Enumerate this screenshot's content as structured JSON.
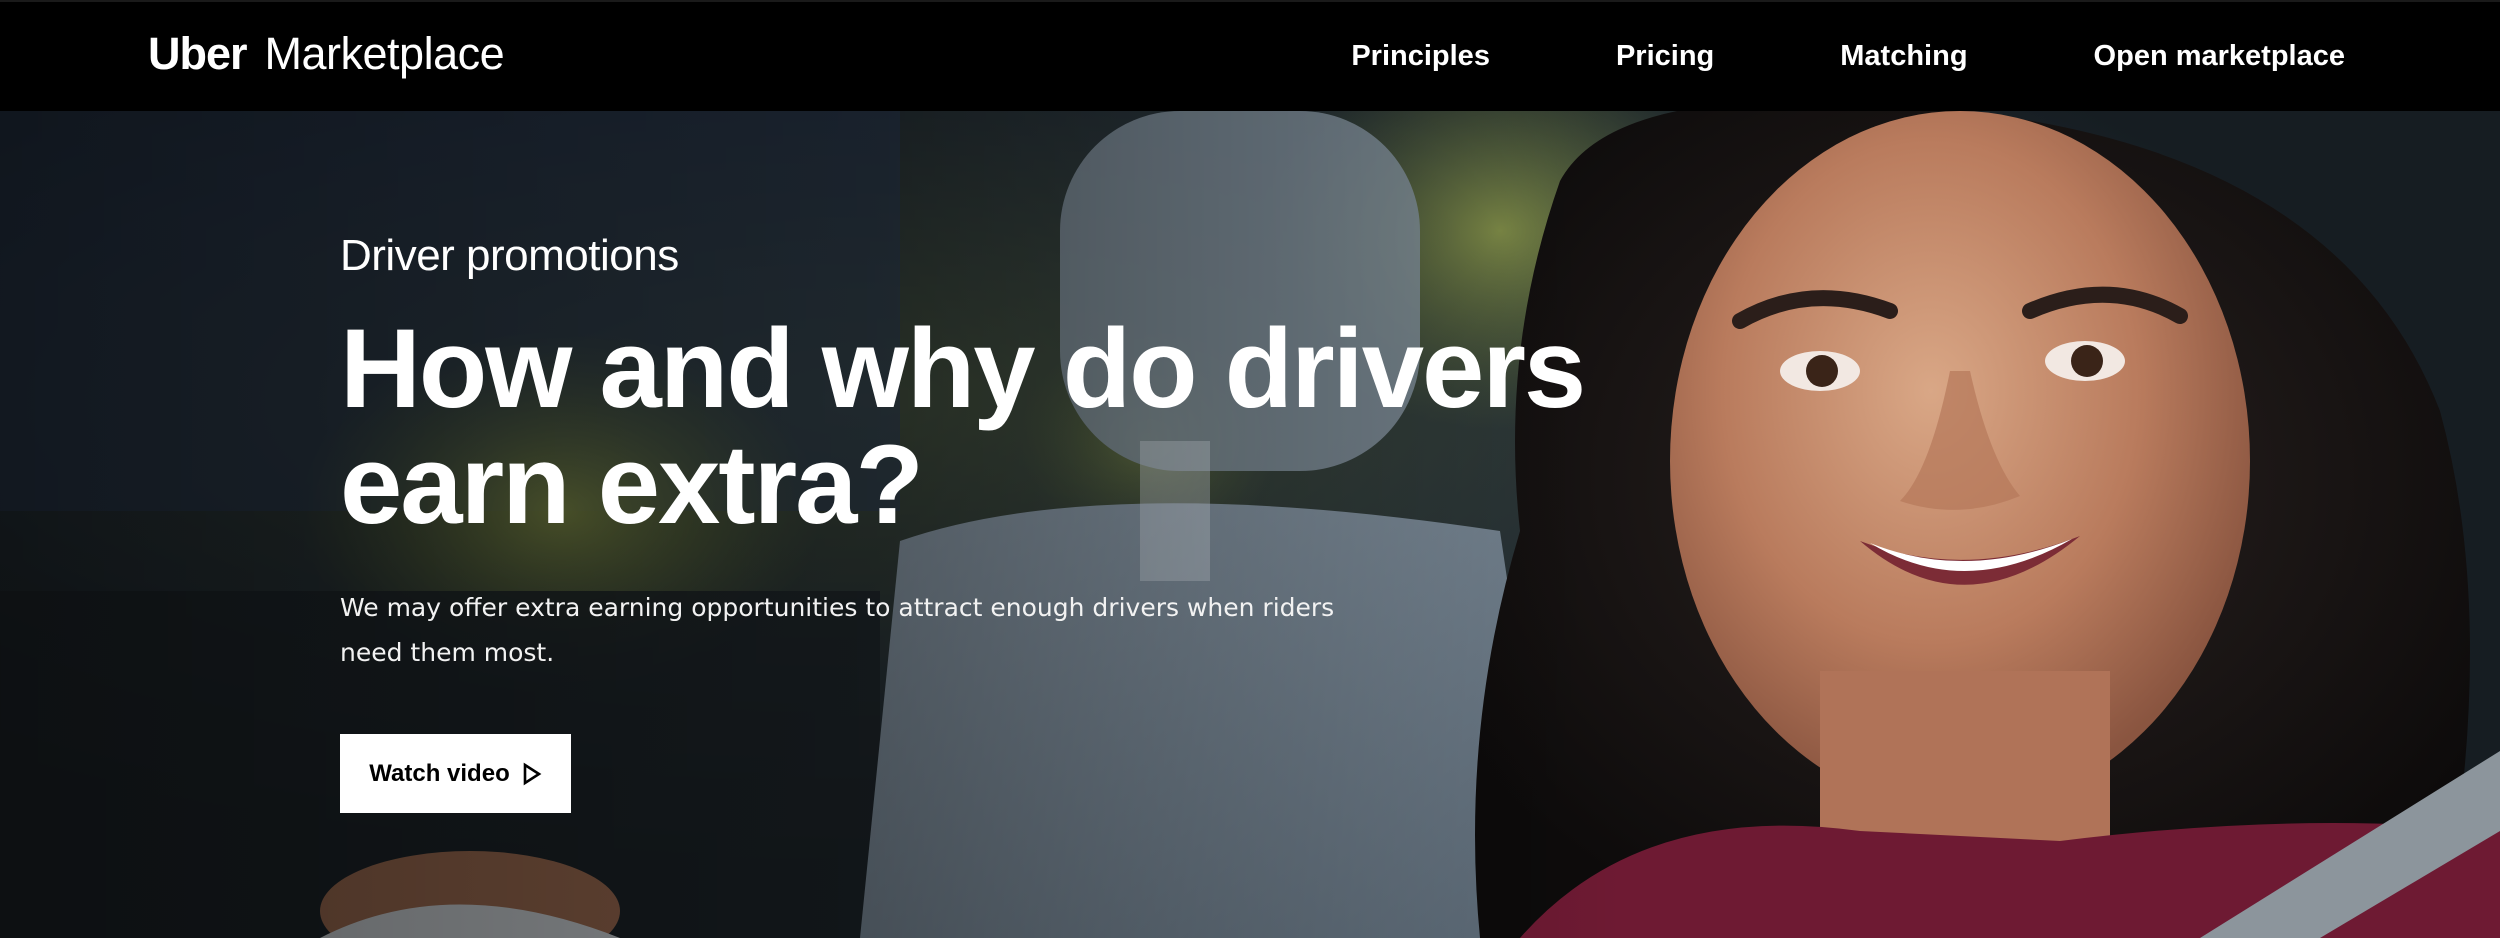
{
  "nav": {
    "logo_brand": "Uber",
    "logo_product": "Marketplace",
    "links": [
      {
        "label": "Principles"
      },
      {
        "label": "Pricing"
      },
      {
        "label": "Matching"
      },
      {
        "label": "Open marketplace"
      }
    ]
  },
  "hero": {
    "eyebrow": "Driver promotions",
    "headline": "How and why do drivers earn extra?",
    "description": "We may offer extra earning opportunities to attract enough drivers when riders need them most.",
    "cta_label": "Watch video",
    "cta_icon": "play-icon",
    "image": "smiling-driver-photo"
  },
  "colors": {
    "nav_background": "#000000",
    "text_on_dark": "#ffffff",
    "button_background": "#ffffff",
    "button_text": "#000000"
  }
}
